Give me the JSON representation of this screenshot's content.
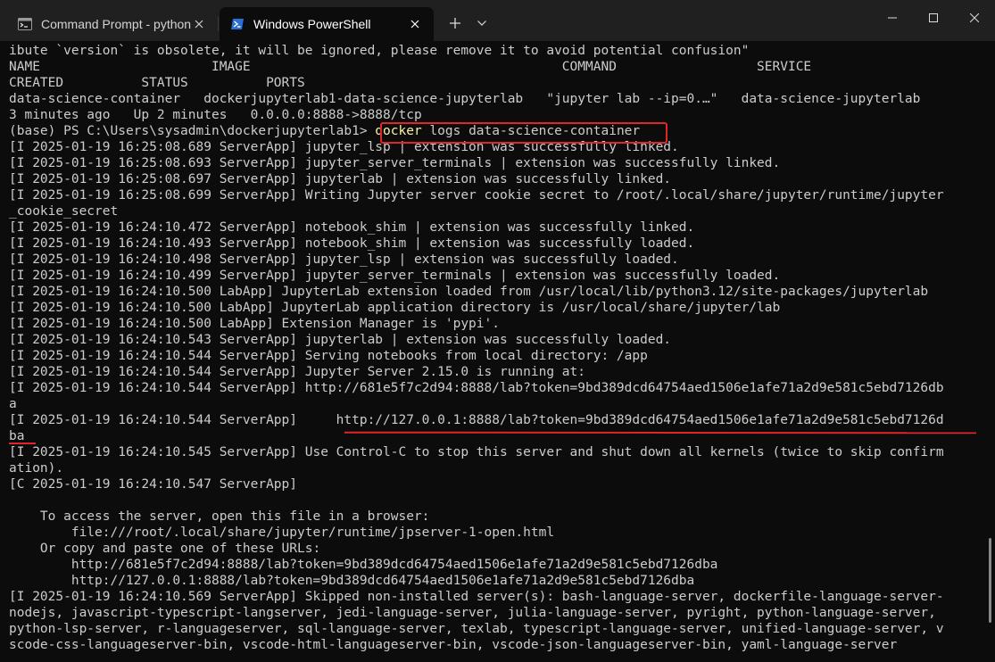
{
  "tabs": [
    {
      "label": "Command Prompt - python",
      "icon": "cmd-icon",
      "active": false
    },
    {
      "label": "Windows PowerShell",
      "icon": "powershell-icon",
      "active": true
    }
  ],
  "colors": {
    "background": "#0c0c0c",
    "titlebar": "#202020",
    "text": "#cccccc",
    "command_highlight": "#f9f1a5",
    "annotation": "#e0252b"
  },
  "terminal": {
    "lines": [
      {
        "text": "ibute `version` is obsolete, it will be ignored, please remove it to avoid potential confusion\""
      },
      {
        "text": "NAME                      IMAGE                                        COMMAND                  SERVICE"
      },
      {
        "text": "CREATED          STATUS          PORTS"
      },
      {
        "text": "data-science-container   dockerjupyterlab1-data-science-jupyterlab   \"jupyter lab --ip=0.…\"   data-science-jupyterlab"
      },
      {
        "text": "3 minutes ago   Up 2 minutes   0.0.0.0:8888->8888/tcp"
      },
      {
        "prompt": "(base) PS C:\\Users\\sysadmin\\dockerjupyterlab1> ",
        "cmd": "docker",
        "args": " logs data-science-container"
      },
      {
        "text": "[I 2025-01-19 16:25:08.689 ServerApp] jupyter_lsp | extension was successfully linked."
      },
      {
        "text": "[I 2025-01-19 16:25:08.693 ServerApp] jupyter_server_terminals | extension was successfully linked."
      },
      {
        "text": "[I 2025-01-19 16:25:08.697 ServerApp] jupyterlab | extension was successfully linked."
      },
      {
        "text": "[I 2025-01-19 16:25:08.699 ServerApp] Writing Jupyter server cookie secret to /root/.local/share/jupyter/runtime/jupyter"
      },
      {
        "text": "_cookie_secret"
      },
      {
        "text": "[I 2025-01-19 16:24:10.472 ServerApp] notebook_shim | extension was successfully linked."
      },
      {
        "text": "[I 2025-01-19 16:24:10.493 ServerApp] notebook_shim | extension was successfully loaded."
      },
      {
        "text": "[I 2025-01-19 16:24:10.498 ServerApp] jupyter_lsp | extension was successfully loaded."
      },
      {
        "text": "[I 2025-01-19 16:24:10.499 ServerApp] jupyter_server_terminals | extension was successfully loaded."
      },
      {
        "text": "[I 2025-01-19 16:24:10.500 LabApp] JupyterLab extension loaded from /usr/local/lib/python3.12/site-packages/jupyterlab"
      },
      {
        "text": "[I 2025-01-19 16:24:10.500 LabApp] JupyterLab application directory is /usr/local/share/jupyter/lab"
      },
      {
        "text": "[I 2025-01-19 16:24:10.500 LabApp] Extension Manager is 'pypi'."
      },
      {
        "text": "[I 2025-01-19 16:24:10.543 ServerApp] jupyterlab | extension was successfully loaded."
      },
      {
        "text": "[I 2025-01-19 16:24:10.544 ServerApp] Serving notebooks from local directory: /app"
      },
      {
        "text": "[I 2025-01-19 16:24:10.544 ServerApp] Jupyter Server 2.15.0 is running at:"
      },
      {
        "text": "[I 2025-01-19 16:24:10.544 ServerApp] http://681e5f7c2d94:8888/lab?token=9bd389dcd64754aed1506e1afe71a2d9e581c5ebd7126db"
      },
      {
        "text": "a"
      },
      {
        "text": "[I 2025-01-19 16:24:10.544 ServerApp]     http://127.0.0.1:8888/lab?token=9bd389dcd64754aed1506e1afe71a2d9e581c5ebd7126d"
      },
      {
        "text": "ba"
      },
      {
        "text": "[I 2025-01-19 16:24:10.545 ServerApp] Use Control-C to stop this server and shut down all kernels (twice to skip confirm"
      },
      {
        "text": "ation)."
      },
      {
        "text": "[C 2025-01-19 16:24:10.547 ServerApp]"
      },
      {
        "text": ""
      },
      {
        "text": "    To access the server, open this file in a browser:"
      },
      {
        "text": "        file:///root/.local/share/jupyter/runtime/jpserver-1-open.html"
      },
      {
        "text": "    Or copy and paste one of these URLs:"
      },
      {
        "text": "        http://681e5f7c2d94:8888/lab?token=9bd389dcd64754aed1506e1afe71a2d9e581c5ebd7126dba"
      },
      {
        "text": "        http://127.0.0.1:8888/lab?token=9bd389dcd64754aed1506e1afe71a2d9e581c5ebd7126dba"
      },
      {
        "text": "[I 2025-01-19 16:24:10.569 ServerApp] Skipped non-installed server(s): bash-language-server, dockerfile-language-server-"
      },
      {
        "text": "nodejs, javascript-typescript-langserver, jedi-language-server, julia-language-server, pyright, python-language-server,"
      },
      {
        "text": "python-lsp-server, r-languageserver, sql-language-server, texlab, typescript-language-server, unified-language-server, v"
      },
      {
        "text": "scode-css-languageserver-bin, vscode-html-languageserver-bin, vscode-json-languageserver-bin, yaml-language-server"
      }
    ]
  }
}
